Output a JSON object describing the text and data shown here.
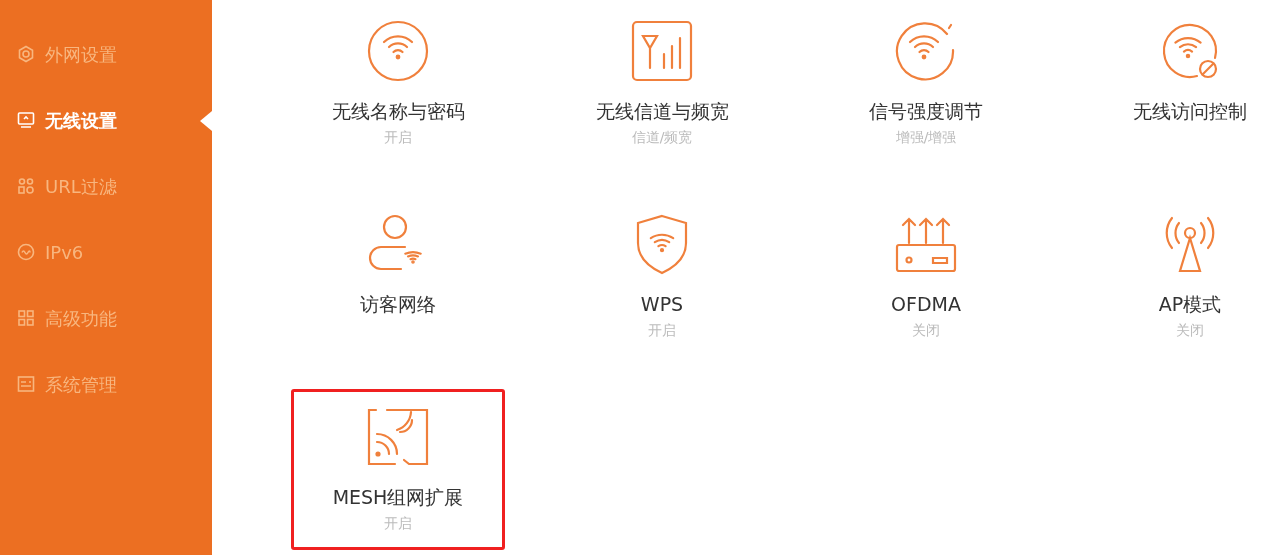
{
  "sidebar": {
    "items": [
      {
        "label": "外网设置",
        "selected": false
      },
      {
        "label": "无线设置",
        "selected": true
      },
      {
        "label": "URL过滤",
        "selected": false
      },
      {
        "label": "IPv6",
        "selected": false
      },
      {
        "label": "高级功能",
        "selected": false
      },
      {
        "label": "系统管理",
        "selected": false
      }
    ]
  },
  "features": [
    {
      "title": "无线名称与密码",
      "status": "开启",
      "highlighted": false
    },
    {
      "title": "无线信道与频宽",
      "status": "信道/频宽",
      "highlighted": false
    },
    {
      "title": "信号强度调节",
      "status": "增强/增强",
      "highlighted": false
    },
    {
      "title": "无线访问控制",
      "highlighted": false
    },
    {
      "title": "访客网络",
      "highlighted": false
    },
    {
      "title": "WPS",
      "status": "开启",
      "highlighted": false
    },
    {
      "title": "OFDMA",
      "status": "关闭",
      "highlighted": false
    },
    {
      "title": "AP模式",
      "status": "关闭",
      "highlighted": false
    },
    {
      "title": "MESH组网扩展",
      "status": "开启",
      "highlighted": true
    }
  ]
}
